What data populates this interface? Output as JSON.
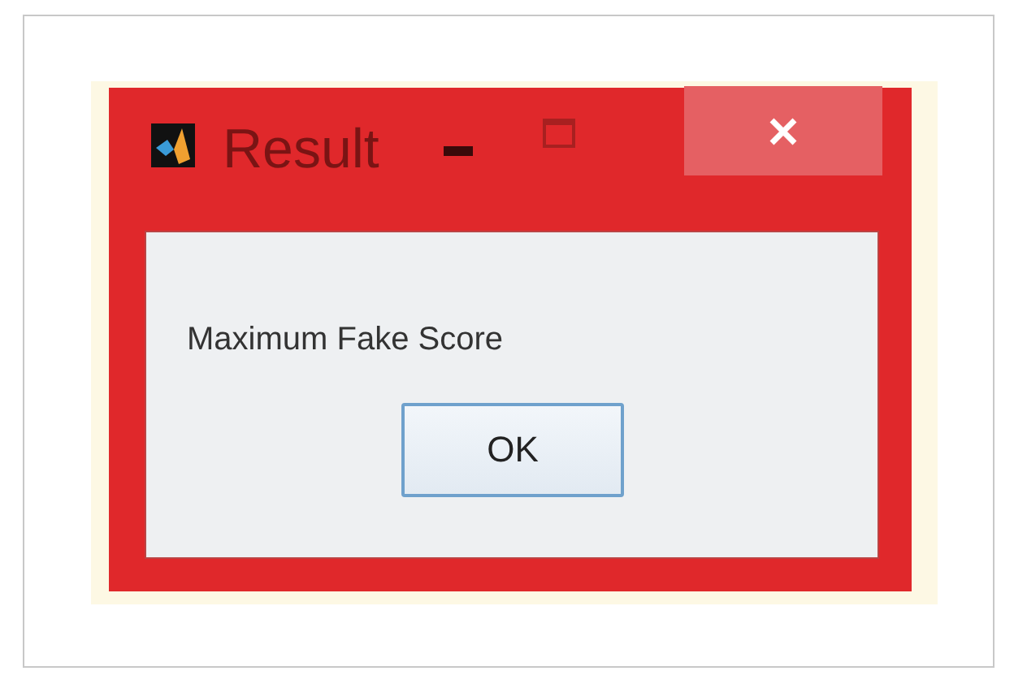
{
  "window": {
    "title": "Result"
  },
  "message": "Maximum Fake Score",
  "buttons": [
    {
      "label": "OK",
      "selected": true
    }
  ]
}
